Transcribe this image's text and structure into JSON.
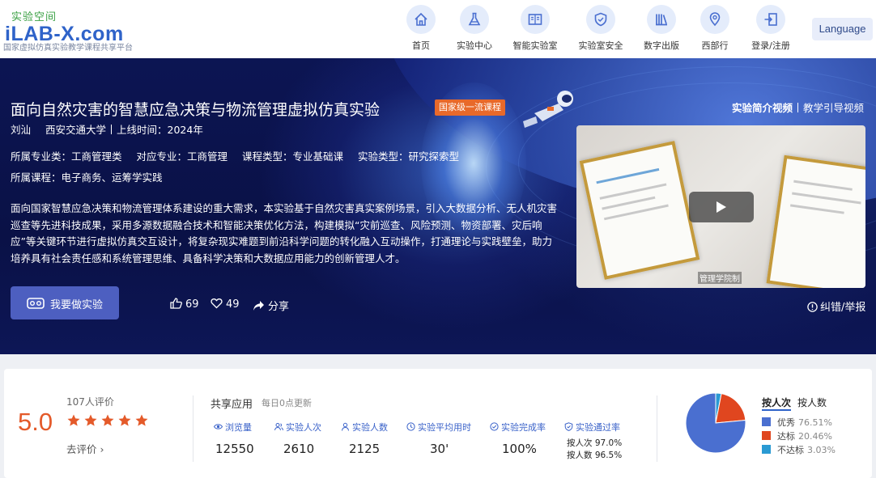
{
  "header": {
    "logo_top": "实验空间",
    "logo_main": "iLAB-X.com",
    "logo_sub": "国家虚拟仿真实验教学课程共享平台",
    "nav": [
      {
        "label": "首页",
        "icon": "home-icon"
      },
      {
        "label": "实验中心",
        "icon": "flask-icon"
      },
      {
        "label": "智能实验室",
        "icon": "book-icon"
      },
      {
        "label": "实验室安全",
        "icon": "shield-icon"
      },
      {
        "label": "数字出版",
        "icon": "books-icon"
      },
      {
        "label": "西部行",
        "icon": "map-pin-icon"
      },
      {
        "label": "登录/注册",
        "icon": "login-icon"
      }
    ],
    "language_label": "Language"
  },
  "course": {
    "title": "面向自然灾害的智慧应急决策与物流管理虚拟仿真实验",
    "badge": "国家级一流课程",
    "author": "刘汕",
    "school": "西安交通大学",
    "online_time": "上线时间：2024年",
    "major_category": "所属专业类：工商管理类",
    "major": "对应专业：工商管理",
    "course_type": "课程类型：专业基础课",
    "experiment_type": "实验类型：研究探索型",
    "courses": "所属课程：电子商务、运筹学实践",
    "description": "面向国家智慧应急决策和物流管理体系建设的重大需求，本实验基于自然灾害真实案例场景，引入大数据分析、无人机灾害巡查等先进科技成果，采用多源数据融合技术和智能决策优化方法，构建模拟“灾前巡查、风险预测、物资部署、灾后响应”等关键环节进行虚拟仿真交互设计，将复杂现实难题到前沿科学问题的转化融入互动操作，打通理论与实践壁垒，助力培养具有社会责任感和系统管理思维、具备科学决策和大数据应用能力的创新管理人才。",
    "do_button": "我要做实验",
    "likes": "69",
    "favorites": "49",
    "share": "分享",
    "video_tab_active": "实验简介视频",
    "video_tab_other": "教学引导视频",
    "video_caption": "管理学院制",
    "report": "纠错/举报"
  },
  "stats": {
    "score": "5.0",
    "review_count": "107人评价",
    "star_count": 5,
    "go_review": "去评价 ›",
    "share_title": "共享应用",
    "update_note": "每日0点更新",
    "columns": [
      {
        "label": "浏览量",
        "value": "12550",
        "icon": "eye-icon"
      },
      {
        "label": "实验人次",
        "value": "2610",
        "icon": "users-icon"
      },
      {
        "label": "实验人数",
        "value": "2125",
        "icon": "user-icon"
      },
      {
        "label": "实验平均用时",
        "value": "30'",
        "icon": "clock-icon"
      },
      {
        "label": "实验完成率",
        "value": "100%",
        "icon": "check-circle-icon"
      },
      {
        "label": "实验通过率",
        "value": "",
        "icon": "shield-check-icon"
      }
    ],
    "pass_by_times": "按人次 97.0%",
    "pass_by_people": "按人数 96.5%",
    "pie_tab_active": "按人次",
    "pie_tab_other": "按人数",
    "pie": [
      {
        "label": "优秀",
        "percent": "76.51%",
        "value": 76.51,
        "color": "#4a6fd0"
      },
      {
        "label": "达标",
        "percent": "20.46%",
        "value": 20.46,
        "color": "#e0461f"
      },
      {
        "label": "不达标",
        "percent": "3.03%",
        "value": 3.03,
        "color": "#2a9ad3"
      }
    ]
  }
}
